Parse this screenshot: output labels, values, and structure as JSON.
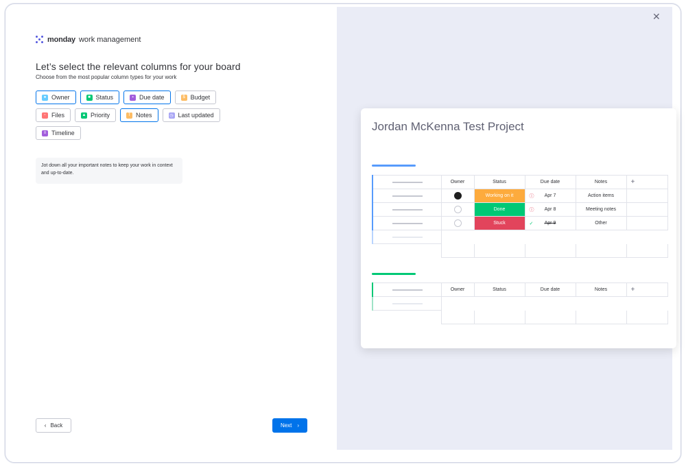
{
  "brand": {
    "name_bold": "monday",
    "name_rest": "work management"
  },
  "heading": {
    "title": "Let’s select the relevant columns for your board",
    "subtitle": "Choose from the most popular column types for your work"
  },
  "chips": [
    {
      "label": "Owner",
      "selected": true,
      "color": "#66ccff",
      "icon": "person-icon"
    },
    {
      "label": "Status",
      "selected": true,
      "color": "#00c875",
      "icon": "status-icon"
    },
    {
      "label": "Due date",
      "selected": true,
      "color": "#a25ddc",
      "icon": "calendar-icon"
    },
    {
      "label": "Budget",
      "selected": false,
      "color": "#fdbc64",
      "icon": "budget-icon"
    },
    {
      "label": "Files",
      "selected": false,
      "color": "#ff7575",
      "icon": "files-icon"
    },
    {
      "label": "Priority",
      "selected": false,
      "color": "#00c875",
      "icon": "priority-icon"
    },
    {
      "label": "Notes",
      "selected": true,
      "color": "#fdbc64",
      "icon": "notes-icon"
    },
    {
      "label": "Last updated",
      "selected": false,
      "color": "#a9a6f5",
      "icon": "last-updated-icon"
    },
    {
      "label": "Timeline",
      "selected": false,
      "color": "#a25ddc",
      "icon": "timeline-icon"
    }
  ],
  "note_text": "Jot down all your important notes to keep your work in context and up-to-date.",
  "buttons": {
    "back": "Back",
    "next": "Next"
  },
  "colors": {
    "accent": "#0073ea",
    "working": "#fdab3d",
    "done": "#00c875",
    "stuck": "#e2445c",
    "group1": "#579bfc",
    "group2": "#00c875"
  },
  "board": {
    "title": "Jordan McKenna Test Project",
    "columns": [
      "Owner",
      "Status",
      "Due date",
      "Notes",
      "+"
    ],
    "rows": [
      {
        "status": "Working on it",
        "status_color": "#fdab3d",
        "due": "Apr 7",
        "notes": "Action items",
        "owner": "filled"
      },
      {
        "status": "Done",
        "status_color": "#00c875",
        "due": "Apr 8",
        "notes": "Meeting notes",
        "owner": "empty"
      },
      {
        "status": "Stuck",
        "status_color": "#e2445c",
        "due": "Apr 9",
        "notes": "Other",
        "owner": "empty"
      }
    ],
    "group2_columns": [
      "Owner",
      "Status",
      "Due date",
      "Notes",
      "+"
    ]
  }
}
